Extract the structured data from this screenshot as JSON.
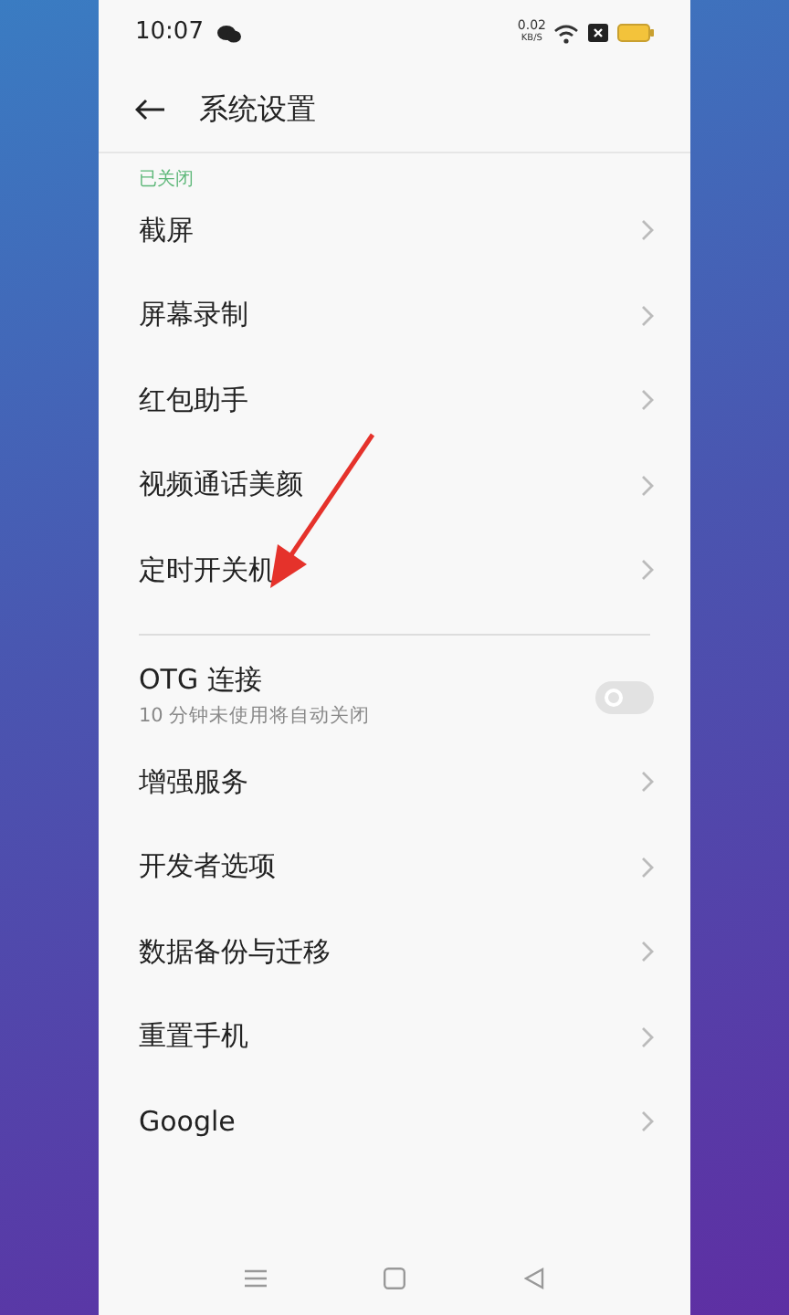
{
  "status_bar": {
    "time": "10:07",
    "net_speed": "0.02",
    "net_unit": "KB/S"
  },
  "header": {
    "title": "系统设置"
  },
  "cut_item": {
    "value": "已关闭"
  },
  "groups": [
    {
      "items": [
        {
          "kind": "link",
          "label": "截屏"
        },
        {
          "kind": "link",
          "label": "屏幕录制"
        },
        {
          "kind": "link",
          "label": "红包助手"
        },
        {
          "kind": "link",
          "label": "视频通话美颜"
        },
        {
          "kind": "link",
          "label": "定时开关机"
        }
      ]
    },
    {
      "items": [
        {
          "kind": "toggle",
          "label": "OTG 连接",
          "subtitle": "10 分钟未使用将自动关闭",
          "on": false
        },
        {
          "kind": "link",
          "label": "增强服务"
        },
        {
          "kind": "link",
          "label": "开发者选项"
        },
        {
          "kind": "link",
          "label": "数据备份与迁移"
        },
        {
          "kind": "link",
          "label": "重置手机"
        },
        {
          "kind": "link",
          "label": "Google"
        }
      ]
    }
  ]
}
